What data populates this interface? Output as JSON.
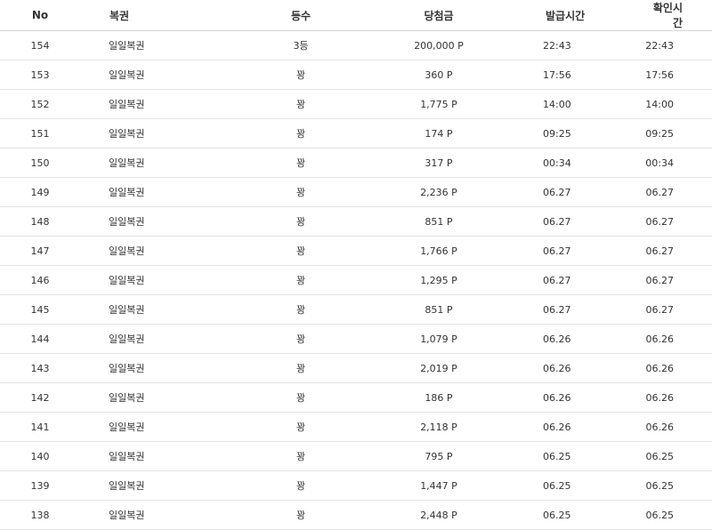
{
  "table": {
    "headers": {
      "no": "No",
      "lottery": "복권",
      "rank": "등수",
      "prize": "당첨금",
      "issued": "발급시간",
      "checked": "확인시간"
    },
    "rows": [
      {
        "no": "154",
        "lottery": "일일복권",
        "rank": "3등",
        "prize": "200,000 P",
        "issued": "22:43",
        "checked": "22:43"
      },
      {
        "no": "153",
        "lottery": "일일복권",
        "rank": "꽝",
        "prize": "360 P",
        "issued": "17:56",
        "checked": "17:56"
      },
      {
        "no": "152",
        "lottery": "일일복권",
        "rank": "꽝",
        "prize": "1,775 P",
        "issued": "14:00",
        "checked": "14:00"
      },
      {
        "no": "151",
        "lottery": "일일복권",
        "rank": "꽝",
        "prize": "174 P",
        "issued": "09:25",
        "checked": "09:25"
      },
      {
        "no": "150",
        "lottery": "일일복권",
        "rank": "꽝",
        "prize": "317 P",
        "issued": "00:34",
        "checked": "00:34"
      },
      {
        "no": "149",
        "lottery": "일일복권",
        "rank": "꽝",
        "prize": "2,236 P",
        "issued": "06.27",
        "checked": "06.27"
      },
      {
        "no": "148",
        "lottery": "일일복권",
        "rank": "꽝",
        "prize": "851 P",
        "issued": "06.27",
        "checked": "06.27"
      },
      {
        "no": "147",
        "lottery": "일일복권",
        "rank": "꽝",
        "prize": "1,766 P",
        "issued": "06.27",
        "checked": "06.27"
      },
      {
        "no": "146",
        "lottery": "일일복권",
        "rank": "꽝",
        "prize": "1,295 P",
        "issued": "06.27",
        "checked": "06.27"
      },
      {
        "no": "145",
        "lottery": "일일복권",
        "rank": "꽝",
        "prize": "851 P",
        "issued": "06.27",
        "checked": "06.27"
      },
      {
        "no": "144",
        "lottery": "일일복권",
        "rank": "꽝",
        "prize": "1,079 P",
        "issued": "06.26",
        "checked": "06.26"
      },
      {
        "no": "143",
        "lottery": "일일복권",
        "rank": "꽝",
        "prize": "2,019 P",
        "issued": "06.26",
        "checked": "06.26"
      },
      {
        "no": "142",
        "lottery": "일일복권",
        "rank": "꽝",
        "prize": "186 P",
        "issued": "06.26",
        "checked": "06.26"
      },
      {
        "no": "141",
        "lottery": "일일복권",
        "rank": "꽝",
        "prize": "2,118 P",
        "issued": "06.26",
        "checked": "06.26"
      },
      {
        "no": "140",
        "lottery": "일일복권",
        "rank": "꽝",
        "prize": "795 P",
        "issued": "06.25",
        "checked": "06.25"
      },
      {
        "no": "139",
        "lottery": "일일복권",
        "rank": "꽝",
        "prize": "1,447 P",
        "issued": "06.25",
        "checked": "06.25"
      },
      {
        "no": "138",
        "lottery": "일일복권",
        "rank": "꽝",
        "prize": "2,448 P",
        "issued": "06.25",
        "checked": "06.25"
      }
    ]
  }
}
